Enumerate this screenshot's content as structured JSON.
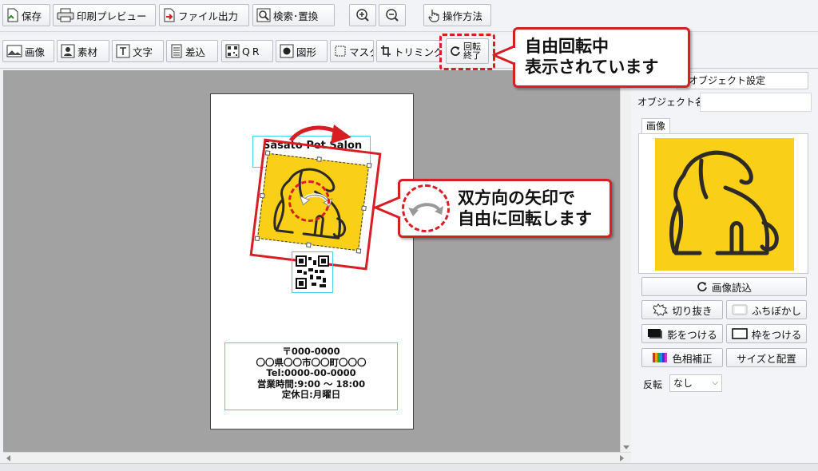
{
  "toolbar1": {
    "save": "保存",
    "print_preview": "印刷プレビュー",
    "file_output": "ファイル出力",
    "search_replace": "検索･置換",
    "how_to": "操作方法"
  },
  "toolbar2": {
    "image": "画像",
    "material": "素材",
    "text": "文字",
    "merge": "差込",
    "qr": "QR",
    "shape": "図形",
    "mask": "マスク",
    "trimming": "トリミング",
    "rotate_end_1": "回転",
    "rotate_end_2": "終了"
  },
  "canvas": {
    "card_title": "Sasato Pet Salon",
    "address_lines": [
      "〒000-0000",
      "〇〇県〇〇市〇〇町〇〇〇",
      "Tel:0000-00-0000",
      "営業時間:9:00 〜 18:00",
      "定休日:月曜日"
    ]
  },
  "callouts": {
    "top_line1": "自由回転中",
    "top_line2": "表示されています",
    "mid_line1": "双方向の矢印で",
    "mid_line2": "自由に回転します"
  },
  "panel": {
    "tab_title": "オブジェクト設定",
    "object_name_label": "オブジェクト名",
    "object_name_value": "",
    "image_tab": "画像",
    "load_image": "画像読込",
    "crop": "切り抜き",
    "blur_edge": "ふちぼかし",
    "shadow": "影をつける",
    "frame": "枠をつける",
    "color_correct": "色相補正",
    "size_position": "サイズと配置",
    "flip_label": "反転",
    "flip_value": "なし"
  },
  "colors": {
    "accent_red": "#d81e25",
    "image_yellow": "#f9cf17",
    "selection_cyan": "#45d4e0",
    "dog_line": "#2d2a28"
  }
}
